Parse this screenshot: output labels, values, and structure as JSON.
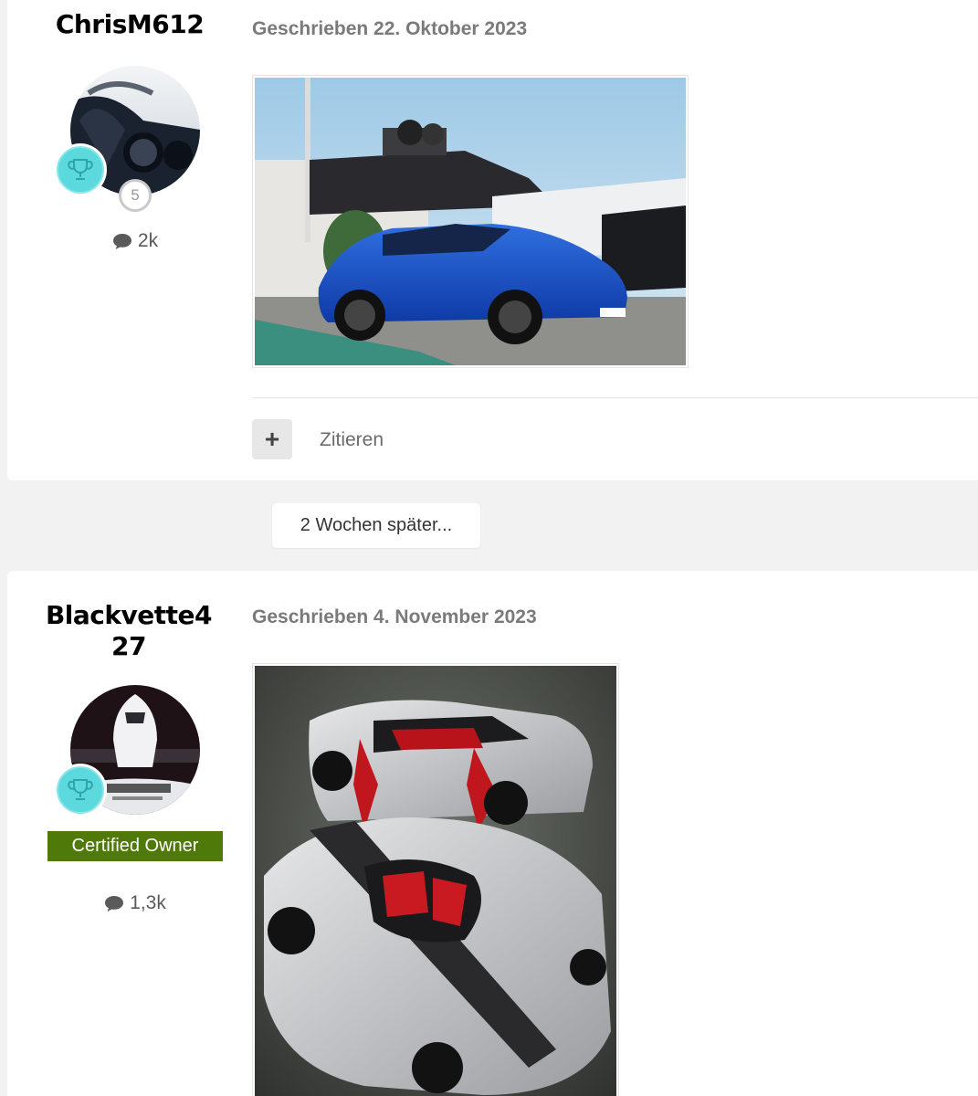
{
  "posts": [
    {
      "author": "ChrisM612",
      "rank_number": "5",
      "post_count": "2k",
      "date": "Geschrieben 22. Oktober 2023",
      "trophy_icon": "trophy-icon",
      "image_alt": "blue-suv-at-harbor",
      "quote_label": "Zitieren",
      "plus_label": "+"
    },
    {
      "author": "Blackvette427",
      "badge": "Certified Owner",
      "post_count": "1,3k",
      "date": "Geschrieben 4. November 2023",
      "trophy_icon": "trophy-icon",
      "image_alt": "two-silver-sports-cars"
    }
  ],
  "time_gap_label": "2 Wochen später...",
  "colors": {
    "background": "#f2f2f2",
    "card": "#ffffff",
    "badge_green": "#4f7a09",
    "trophy_cyan": "#5cd9dd"
  }
}
